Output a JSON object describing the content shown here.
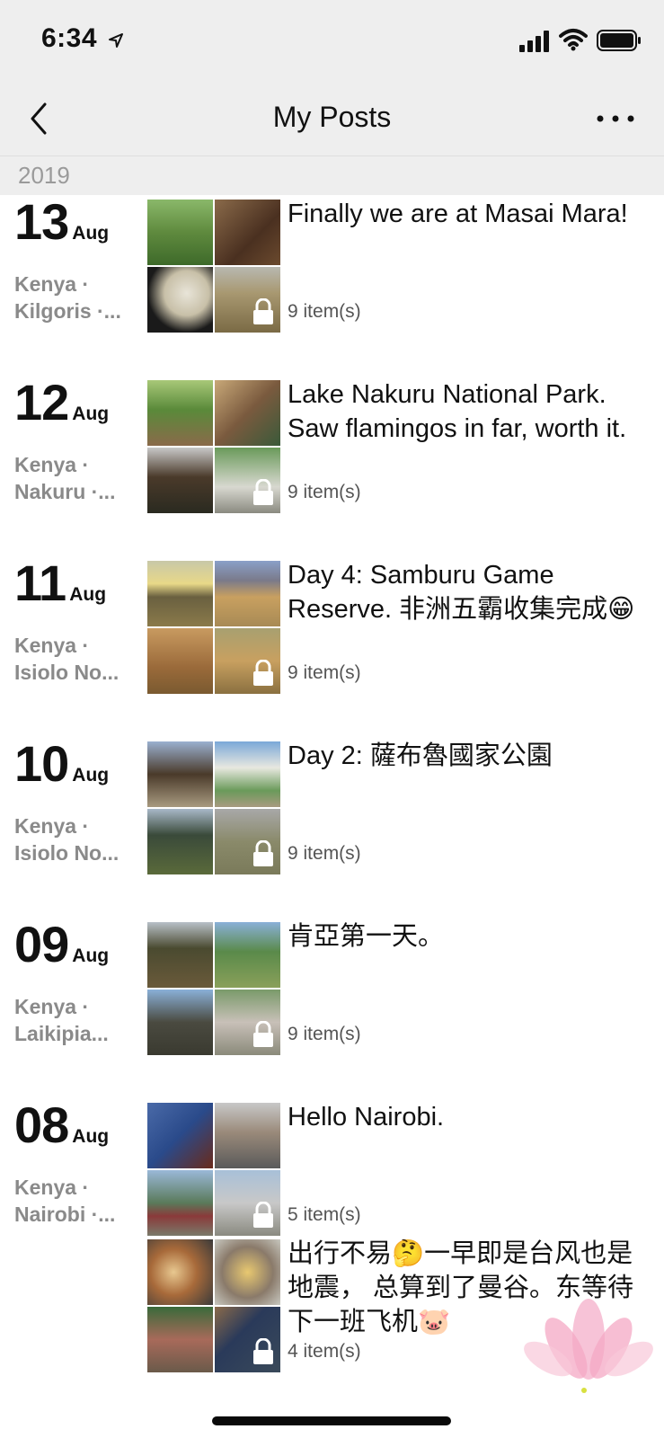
{
  "status_bar": {
    "time": "6:34"
  },
  "nav": {
    "title": "My Posts"
  },
  "year": "2019",
  "posts": [
    {
      "day": "13",
      "month": "Aug",
      "place_line1": "Kenya ·",
      "place_line2": "Kilgoris ·...",
      "caption": "Finally we are at Masai Mara!",
      "count": "9 item(s)",
      "thumb_colors": [
        "#5f8a3e",
        "#6b4a2e",
        "#2a2a2a",
        "#8a7b55"
      ]
    },
    {
      "day": "12",
      "month": "Aug",
      "place_line1": "Kenya ·",
      "place_line2": "Nakuru ·...",
      "caption": "Lake Nakuru National Park. Saw flamingos in far, worth it.",
      "count": "9 item(s)",
      "thumb_colors": [
        "#4f7a3a",
        "#7a5a3e",
        "#3a3a2e",
        "#6a8a6a"
      ]
    },
    {
      "day": "11",
      "month": "Aug",
      "place_line1": "Kenya ·",
      "place_line2": "Isiolo No...",
      "caption": "Day 4: Samburu Game Reserve. 非洲五霸收集完成😁",
      "count": "9 item(s)",
      "thumb_colors": [
        "#8a7a4a",
        "#a88a55",
        "#9a6a3a",
        "#a88a55"
      ]
    },
    {
      "day": "10",
      "month": "Aug",
      "place_line1": "Kenya ·",
      "place_line2": "Isiolo No...",
      "caption": "Day 2: 薩布魯國家公園",
      "count": "9 item(s)",
      "thumb_colors": [
        "#7a8aa8",
        "#6a9a6a",
        "#4a5a3a",
        "#8a8a6a"
      ]
    },
    {
      "day": "09",
      "month": "Aug",
      "place_line1": "Kenya ·",
      "place_line2": "Laikipia...",
      "caption": "肯亞第一天。",
      "count": "9 item(s)",
      "thumb_colors": [
        "#5a5a3a",
        "#6a8a5a",
        "#4a5a6a",
        "#8a8a7a"
      ]
    },
    {
      "day": "08",
      "month": "Aug",
      "place_line1": "Kenya ·",
      "place_line2": "Nairobi ·...",
      "caption": "Hello Nairobi.",
      "count": "5 item(s)",
      "thumb_colors": [
        "#2a4a8a",
        "#8a8a8a",
        "#3a6a8a",
        "#9aa8b8"
      ]
    },
    {
      "day": "",
      "month": "",
      "place_line1": "",
      "place_line2": "",
      "caption": "出行不易🤔一早即是台风也是地震， 总算到了曼谷。东等待下一班飞机🐷",
      "count": "4 item(s)",
      "thumb_colors": [
        "#a86a3a",
        "#8a7a6a",
        "#6a5a4a",
        "#3a4a5a"
      ]
    }
  ]
}
